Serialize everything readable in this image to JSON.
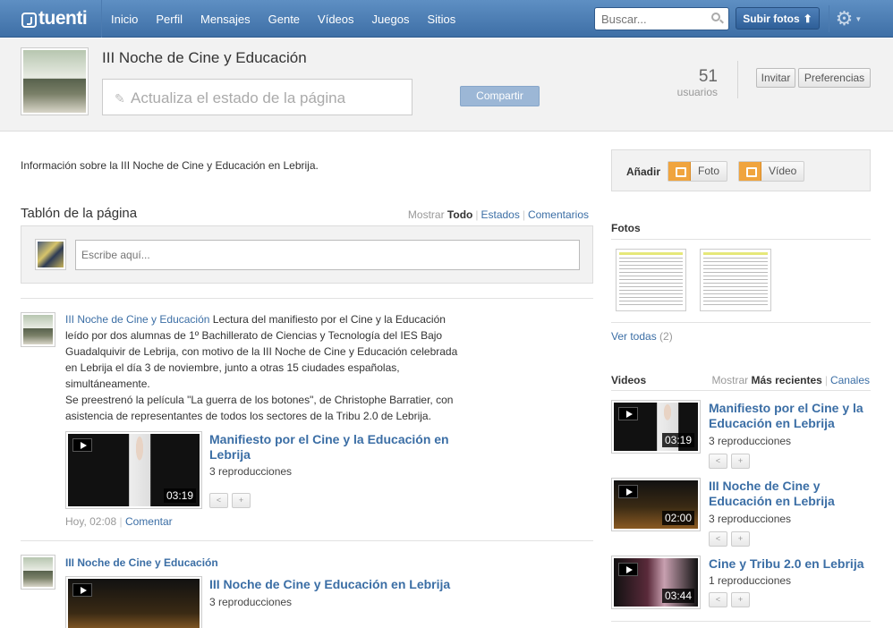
{
  "topbar": {
    "logo": "tuenti",
    "nav": [
      "Inicio",
      "Perfil",
      "Mensajes",
      "Gente",
      "Vídeos",
      "Juegos",
      "Sitios"
    ],
    "search_placeholder": "Buscar...",
    "upload_label": "Subir fotos"
  },
  "header": {
    "title": "III Noche de Cine y Educación",
    "status_placeholder": "Actualiza el estado de la página",
    "share_label": "Compartir",
    "user_count": "51",
    "user_count_label": "usuarios",
    "invite_label": "Invitar",
    "prefs_label": "Preferencias"
  },
  "main": {
    "info": "Información sobre la III Noche de Cine y Educación en Lebrija.",
    "wall_title": "Tablón de la página",
    "filter_label": "Mostrar",
    "filter_all": "Todo",
    "filter_states": "Estados",
    "filter_comments": "Comentarios",
    "composer_placeholder": "Escribe aquí...",
    "posts": [
      {
        "author": "III Noche de Cine y Educación",
        "lines": [
          "Lectura del manifiesto por el Cine y la Educación",
          "leído por dos alumnas de 1º Bachillerato de Ciencias y Tecnología del IES Bajo",
          "Guadalquivir de Lebrija, con motivo de la III Noche de Cine y Educación celebrada",
          "en Lebrija el día 3 de noviembre, junto a otras 15 ciudades españolas,",
          "simultáneamente.",
          "Se preestrenó la película \"La guerra de los botones\", de Christophe Barratier, con",
          "asistencia de representantes de todos los sectores de la Tribu 2.0 de Lebrija."
        ],
        "video_title_1": "Manifiesto por el Cine y la Educación en",
        "video_title_2": "Lebrija",
        "video_views": "3 reproducciones",
        "video_duration": "03:19",
        "time": "Hoy, 02:08",
        "comment": "Comentar"
      },
      {
        "author": "III Noche de Cine y Educación",
        "video_title": "III Noche de Cine y Educación en Lebrija",
        "video_views": "3 reproducciones"
      }
    ]
  },
  "sidebar": {
    "add_label": "Añadir",
    "add_photo": "Foto",
    "add_video": "Vídeo",
    "photos_title": "Fotos",
    "see_all": "Ver todas",
    "see_all_count": "(2)",
    "videos_title": "Videos",
    "videos_filter_label": "Mostrar",
    "videos_recent": "Más recientes",
    "videos_channels": "Canales",
    "videos": [
      {
        "title_1": "Manifiesto por el Cine y la",
        "title_2": "Educación en Lebrija",
        "views": "3 reproducciones",
        "duration": "03:19"
      },
      {
        "title_1": "III Noche de Cine y",
        "title_2": "Educación en Lebrija",
        "views": "3 reproducciones",
        "duration": "02:00"
      },
      {
        "title_1": "Cine y Tribu 2.0 en Lebrija",
        "views": "1 reproducciones",
        "duration": "03:44"
      }
    ]
  }
}
